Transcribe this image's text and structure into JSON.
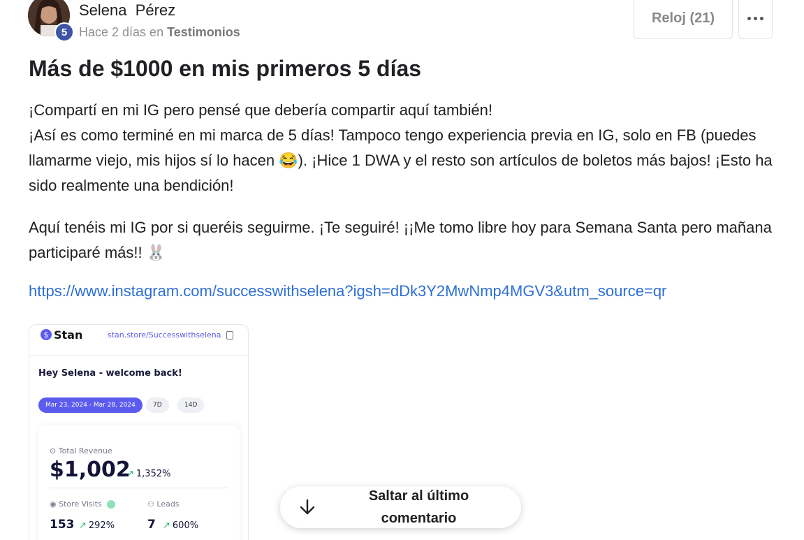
{
  "author": {
    "name": "Selena  Pérez",
    "level": "5",
    "time": "Hace 2 días en",
    "category": "Testimonios"
  },
  "actions": {
    "watch_label": "Reloj (21)"
  },
  "post": {
    "title": "Más de $1000 en mis primeros 5 días",
    "paragraph_1_line_1": "¡Compartí en mi IG pero pensé que debería compartir aquí también!",
    "paragraph_1_line_2": "¡Así es como terminé en mi marca de 5 días! Tampoco tengo experiencia previa en IG, solo en FB (puedes llamarme viejo, mis hijos sí lo hacen 😂). ¡Hice 1 DWA y el resto son artículos de boletos más bajos! ¡Esto ha sido realmente una bendición!",
    "paragraph_2": "Aquí tenéis mi IG por si queréis seguirme. ¡Te seguiré! ¡¡Me tomo libre hoy para Semana Santa pero mañana participaré más!! 🐰",
    "link": "https://www.instagram.com/successwithselena?igsh=dDk3Y2MwNmp4MGV3&utm_source=qr"
  },
  "stan_card": {
    "brand": "Stan",
    "url": "stan.store/Successwithselena",
    "greeting": "Hey Selena - welcome back!",
    "range": "Mar 23, 2024 - Mar 28, 2024",
    "chip_7d": "7D",
    "chip_14d": "14D",
    "revenue_label": "Total Revenue",
    "revenue_value": "$1,002",
    "revenue_change": "1,352%",
    "visits_label": "Store Visits",
    "visits_value": "153",
    "visits_change": "292%",
    "leads_label": "Leads",
    "leads_value": "7",
    "leads_change": "600%"
  },
  "jump": {
    "label": "Saltar al último comentario"
  }
}
